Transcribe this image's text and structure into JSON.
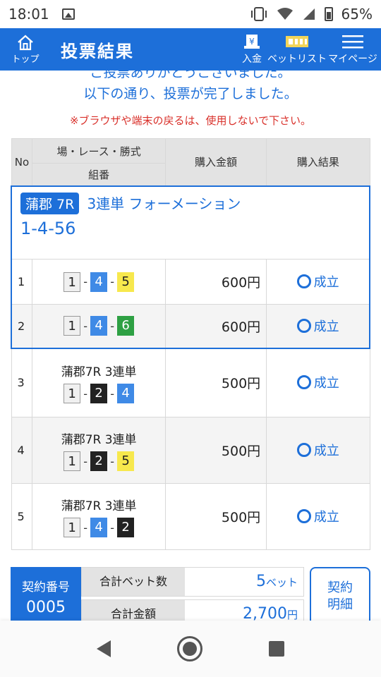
{
  "status_bar": {
    "time": "18:01",
    "battery": "65%"
  },
  "header": {
    "home_label": "トップ",
    "title": "投票結果",
    "deposit_label": "入金",
    "betlist_label": "ベットリスト",
    "mypage_label": "マイページ",
    "accent": "#1d6fd9"
  },
  "messages": {
    "partial": "ご投票ありがとうございました。",
    "main": "以下の通り、投票が完了しました。",
    "warning": "※ブラウザや端末の戻るは、使用しないで下さい。"
  },
  "table": {
    "headers": {
      "no": "No",
      "combo_top": "場・レース・勝式",
      "combo_bottom": "組番",
      "amount": "購入金額",
      "result": "購入結果"
    },
    "group": {
      "venue_badge": "蒲郡 7R",
      "bet_type": "3連単 フォーメーション",
      "combo": "1-4-56",
      "rows": [
        {
          "no": "1",
          "nums": [
            "1",
            "4",
            "5"
          ],
          "amount": "600円",
          "result": "成立"
        },
        {
          "no": "2",
          "nums": [
            "1",
            "4",
            "6"
          ],
          "amount": "600円",
          "result": "成立"
        }
      ]
    },
    "rows": [
      {
        "no": "3",
        "venue": "蒲郡7R 3連単",
        "nums": [
          "1",
          "2",
          "4"
        ],
        "amount": "500円",
        "result": "成立"
      },
      {
        "no": "4",
        "venue": "蒲郡7R 3連単",
        "nums": [
          "1",
          "2",
          "5"
        ],
        "amount": "500円",
        "result": "成立"
      },
      {
        "no": "5",
        "venue": "蒲郡7R 3連単",
        "nums": [
          "1",
          "4",
          "2"
        ],
        "amount": "500円",
        "result": "成立"
      }
    ],
    "separator": "-"
  },
  "summary": {
    "contract_label": "契約番号",
    "contract_no": "0005",
    "total_bets_label": "合計ベット数",
    "total_bets_value": "5",
    "total_bets_unit": "ベット",
    "total_amount_label": "合計金額",
    "total_amount_value": "2,700",
    "total_amount_unit": "円",
    "detail_line1": "契約",
    "detail_line2": "明細"
  }
}
